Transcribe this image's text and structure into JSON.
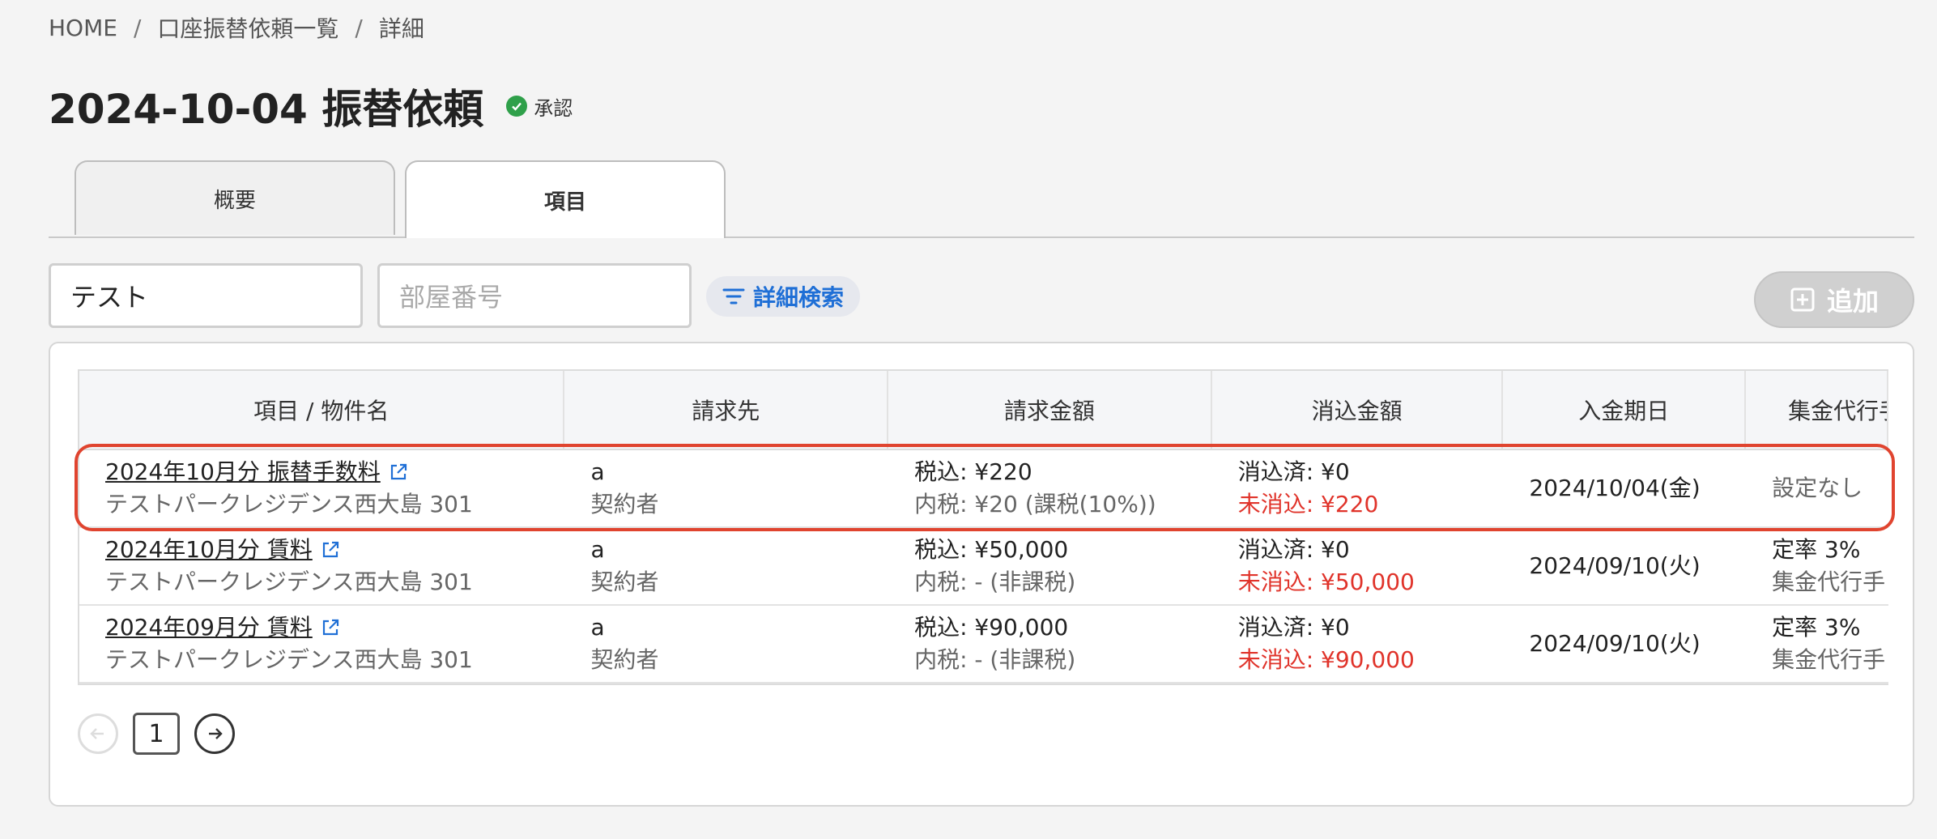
{
  "breadcrumb": {
    "home": "HOME",
    "list": "口座振替依頼一覧",
    "current": "詳細",
    "sep": "/"
  },
  "header": {
    "title": "2024-10-04 振替依頼",
    "status": "承認",
    "status_color": "#2fa04a"
  },
  "tabs": [
    {
      "label": "概要",
      "active": false
    },
    {
      "label": "項目",
      "active": true
    }
  ],
  "filters": {
    "name_value": "テスト",
    "room_placeholder": "部屋番号",
    "detail_search_label": "詳細検索",
    "add_label": "追加"
  },
  "table": {
    "columns": [
      "項目 / 物件名",
      "請求先",
      "請求金額",
      "消込金額",
      "入金期日",
      "集金代行手"
    ],
    "rows": [
      {
        "item": "2024年10月分 振替手数料",
        "property": "テストパークレジデンス西大島 301",
        "payer": "a",
        "payer_role": "契約者",
        "billed": "税込: ¥220",
        "tax": "内税: ¥20 (課税(10%))",
        "cleared": "消込済: ¥0",
        "uncleared": "未消込: ¥220",
        "due": "2024/10/04(金)",
        "agency": "設定なし",
        "agency_sub": ""
      },
      {
        "item": "2024年10月分 賃料",
        "property": "テストパークレジデンス西大島 301",
        "payer": "a",
        "payer_role": "契約者",
        "billed": "税込: ¥50,000",
        "tax": "内税: - (非課税)",
        "cleared": "消込済: ¥0",
        "uncleared": "未消込: ¥50,000",
        "due": "2024/09/10(火)",
        "agency": "定率 3%",
        "agency_sub": "集金代行手"
      },
      {
        "item": "2024年09月分 賃料",
        "property": "テストパークレジデンス西大島 301",
        "payer": "a",
        "payer_role": "契約者",
        "billed": "税込: ¥90,000",
        "tax": "内税: - (非課税)",
        "cleared": "消込済: ¥0",
        "uncleared": "未消込: ¥90,000",
        "due": "2024/09/10(火)",
        "agency": "定率 3%",
        "agency_sub": "集金代行手"
      }
    ]
  },
  "pagination": {
    "current": "1"
  },
  "colors": {
    "accent": "#1f6fd6",
    "highlight": "#e0442f",
    "uncleared": "#e0332a"
  }
}
